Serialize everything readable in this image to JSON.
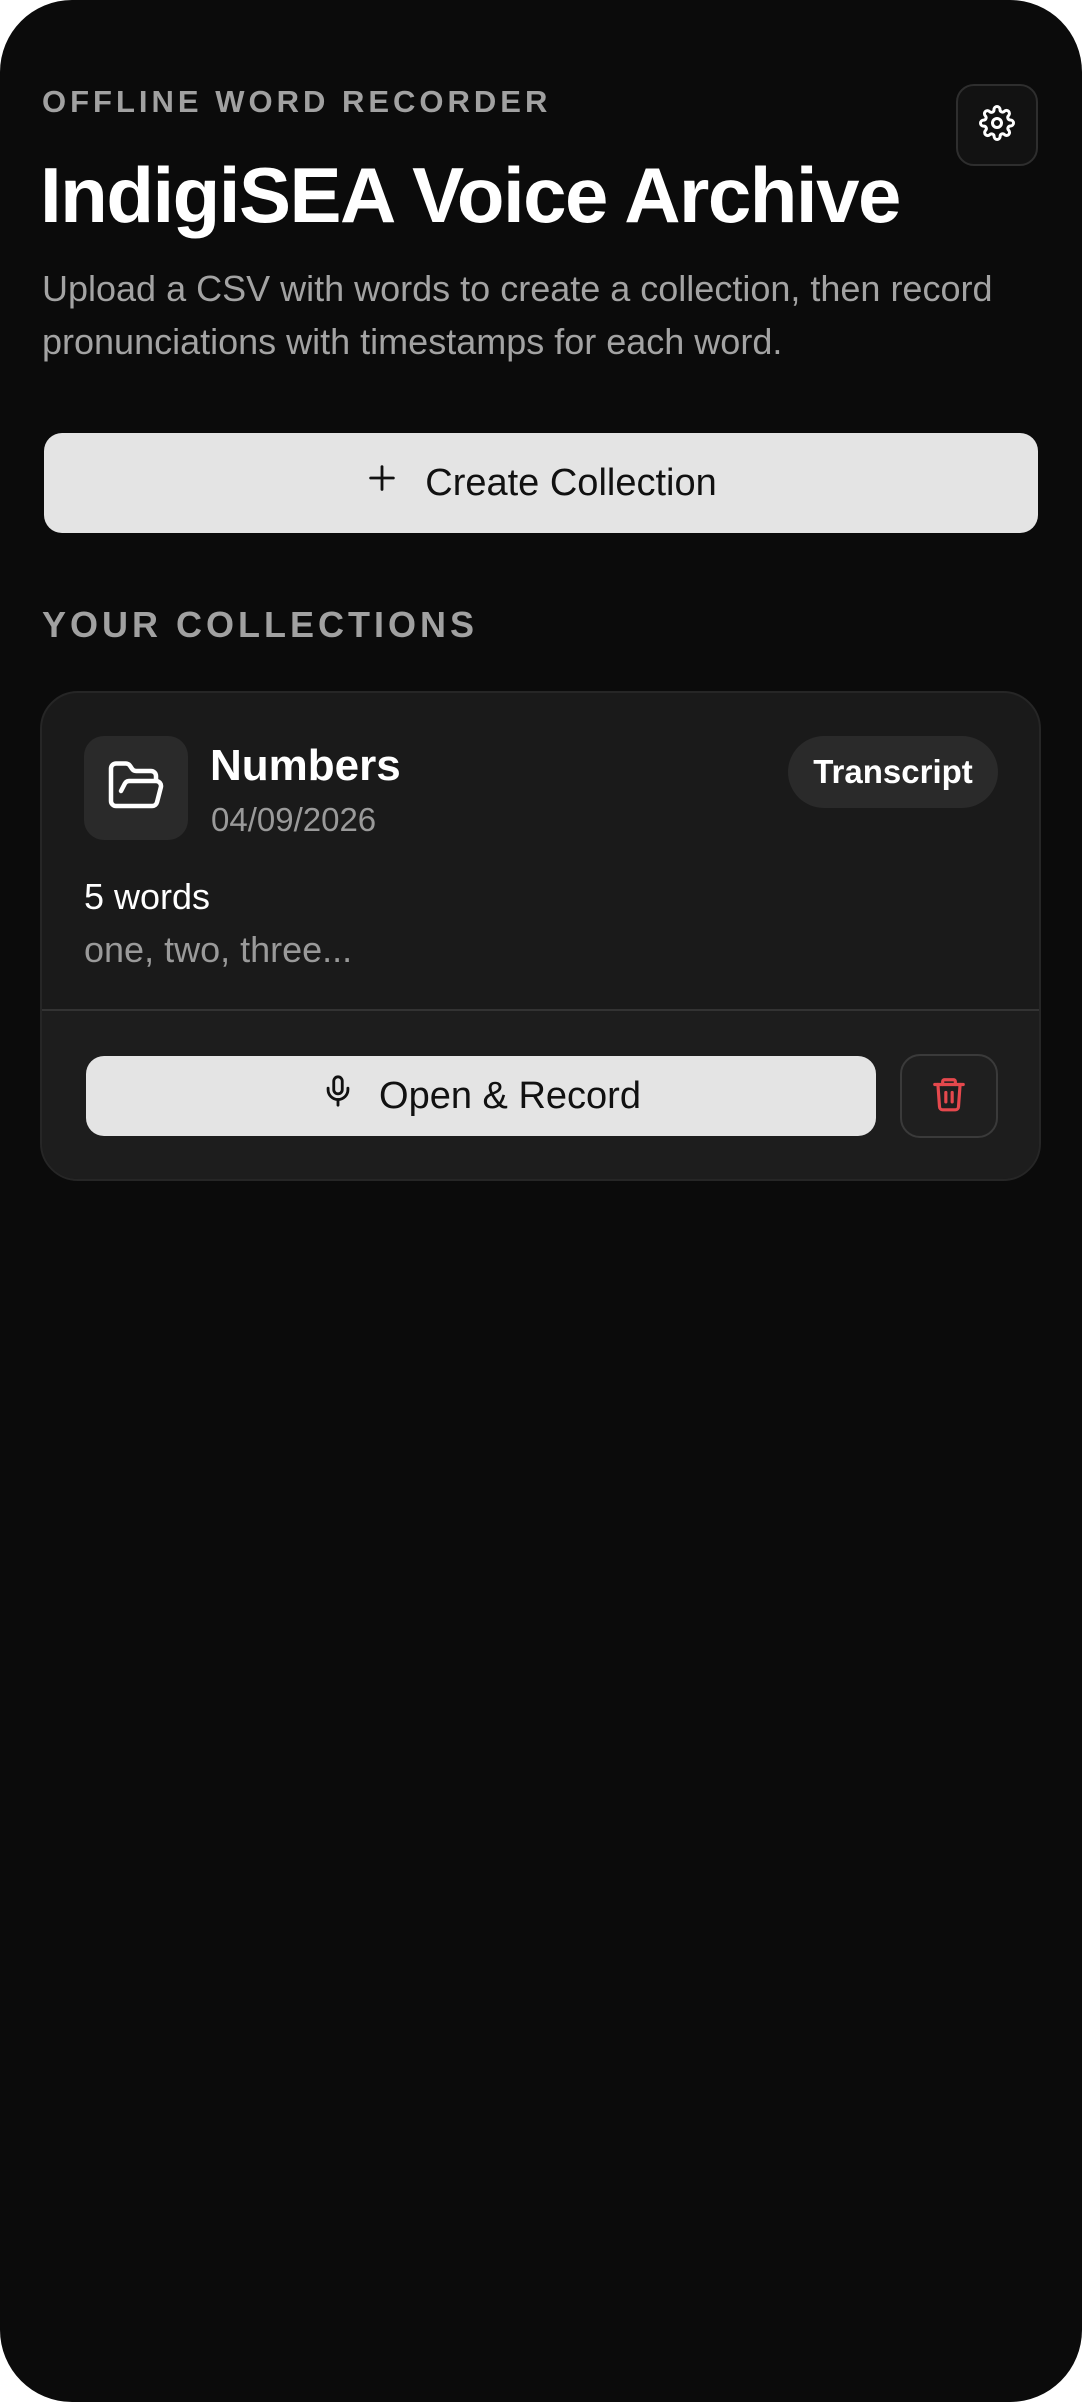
{
  "header": {
    "eyebrow": "OFFLINE WORD RECORDER",
    "title": "IndigiSEA Voice Archive",
    "subtitle": "Upload a CSV with words to create a collection, then record pronunciations with timestamps for each word.",
    "settings_icon": "gear-icon"
  },
  "actions": {
    "create_label": "Create Collection",
    "create_icon": "plus-icon"
  },
  "collections": {
    "section_label": "YOUR COLLECTIONS",
    "items": [
      {
        "name": "Numbers",
        "date": "04/09/2026",
        "badge": "Transcript",
        "word_count": "5 words",
        "preview": "one, two, three...",
        "icon": "folder-open-icon",
        "open_label": "Open & Record",
        "open_icon": "microphone-icon",
        "delete_icon": "trash-icon"
      }
    ]
  },
  "colors": {
    "background": "#0b0b0b",
    "card": "#1a1a1a",
    "button": "#e4e4e4",
    "muted_text": "#a1a1a1",
    "danger": "#e5484d"
  }
}
